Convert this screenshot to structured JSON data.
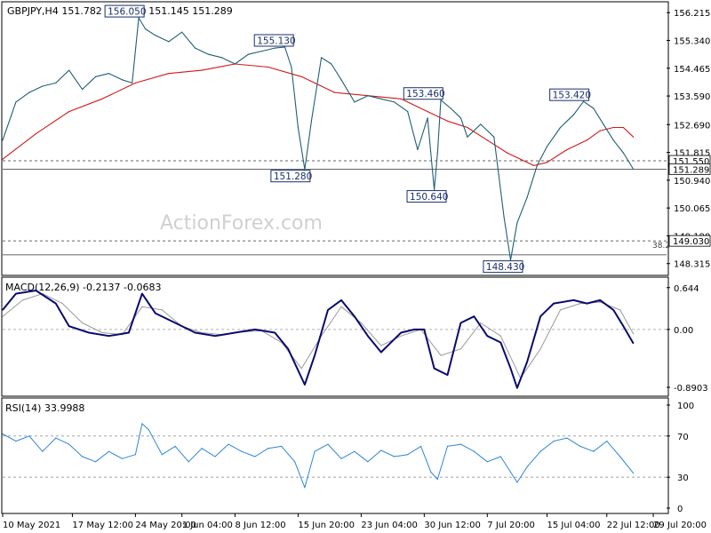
{
  "colors": {
    "price": "#1f5f73",
    "ma": "#d01818",
    "macd_main": "#0a0a70",
    "macd_signal": "#9a9a9a",
    "rsi": "#2e86d6",
    "label_border": "#1a2f6b",
    "axis_text": "#000000",
    "watermark": "#d6d6d6",
    "level_line": "#333333",
    "grid_dash": "#999999"
  },
  "chart_data": [
    {
      "type": "line",
      "header": "GBPJPY,H4  151.782 151.782 151.145 151.289",
      "watermark": "ActionForex.com",
      "yaxis_ticks": [
        "156.215",
        "155.340",
        "154.465",
        "153.590",
        "152.690",
        "151.815",
        "150.940",
        "150.065",
        "149.190",
        "148.315"
      ],
      "ylim": [
        148.0,
        156.5
      ],
      "current_price": "151.289",
      "horizontal_levels": [
        {
          "value": 151.55,
          "label": "151.550",
          "style": "dashed"
        },
        {
          "value": 151.289,
          "label": "151.289",
          "style": "solid"
        },
        {
          "value": 149.03,
          "label": "149.030",
          "style": "dashed",
          "note": "38.2"
        },
        {
          "value": 148.59,
          "label": "",
          "style": "solid"
        }
      ],
      "annotations": [
        {
          "text": "156.050",
          "x": 0.205
        },
        {
          "text": "155.130",
          "x": 0.43
        },
        {
          "text": "151.280",
          "x": 0.455
        },
        {
          "text": "153.460",
          "x": 0.655
        },
        {
          "text": "150.640",
          "x": 0.66
        },
        {
          "text": "148.430",
          "x": 0.775
        },
        {
          "text": "153.420",
          "x": 0.875
        }
      ],
      "series": [
        {
          "name": "price",
          "x": [
            0,
            0.02,
            0.04,
            0.06,
            0.08,
            0.1,
            0.12,
            0.14,
            0.16,
            0.18,
            0.195,
            0.205,
            0.215,
            0.23,
            0.25,
            0.27,
            0.29,
            0.31,
            0.33,
            0.35,
            0.37,
            0.39,
            0.41,
            0.425,
            0.435,
            0.445,
            0.455,
            0.465,
            0.48,
            0.495,
            0.51,
            0.53,
            0.55,
            0.57,
            0.59,
            0.61,
            0.625,
            0.64,
            0.65,
            0.655,
            0.66,
            0.675,
            0.69,
            0.7,
            0.72,
            0.74,
            0.755,
            0.765,
            0.775,
            0.79,
            0.805,
            0.82,
            0.84,
            0.86,
            0.875,
            0.89,
            0.905,
            0.92,
            0.935,
            0.95
          ],
          "values": [
            152.2,
            153.4,
            153.7,
            153.9,
            154.0,
            154.4,
            153.8,
            154.2,
            154.3,
            154.1,
            154.0,
            156.05,
            155.7,
            155.5,
            155.3,
            155.6,
            155.1,
            154.9,
            154.8,
            154.6,
            154.9,
            155.0,
            155.1,
            155.13,
            154.5,
            152.6,
            151.28,
            152.8,
            154.8,
            154.6,
            154.1,
            153.4,
            153.6,
            153.5,
            153.4,
            153.1,
            151.9,
            152.9,
            150.64,
            151.8,
            153.46,
            153.2,
            152.9,
            152.3,
            152.7,
            152.3,
            149.8,
            148.43,
            149.6,
            150.4,
            151.4,
            152.0,
            152.6,
            153.0,
            153.42,
            153.2,
            152.7,
            152.2,
            151.8,
            151.289
          ]
        },
        {
          "name": "moving-average",
          "x": [
            0,
            0.05,
            0.1,
            0.15,
            0.2,
            0.25,
            0.3,
            0.35,
            0.4,
            0.45,
            0.47,
            0.5,
            0.55,
            0.6,
            0.64,
            0.67,
            0.7,
            0.73,
            0.76,
            0.78,
            0.8,
            0.82,
            0.85,
            0.88,
            0.9,
            0.92,
            0.935,
            0.95
          ],
          "values": [
            151.6,
            152.4,
            153.1,
            153.5,
            154.0,
            154.3,
            154.4,
            154.6,
            154.5,
            154.2,
            154.0,
            153.7,
            153.6,
            153.5,
            153.1,
            152.8,
            152.6,
            152.2,
            151.8,
            151.6,
            151.4,
            151.5,
            151.9,
            152.2,
            152.5,
            152.6,
            152.6,
            152.3
          ]
        }
      ]
    },
    {
      "type": "line",
      "title": "MACD(12,26,9) -0.2137 -0.0683",
      "yaxis_ticks": [
        "0.644",
        "0.00",
        "-0.8903"
      ],
      "ylim": [
        -1.0,
        0.75
      ],
      "series": [
        {
          "name": "main",
          "x": [
            0,
            0.02,
            0.05,
            0.08,
            0.1,
            0.13,
            0.16,
            0.19,
            0.21,
            0.23,
            0.26,
            0.29,
            0.32,
            0.35,
            0.38,
            0.41,
            0.43,
            0.455,
            0.47,
            0.49,
            0.51,
            0.53,
            0.55,
            0.57,
            0.59,
            0.6,
            0.62,
            0.635,
            0.65,
            0.67,
            0.69,
            0.71,
            0.73,
            0.75,
            0.765,
            0.775,
            0.79,
            0.81,
            0.83,
            0.86,
            0.88,
            0.9,
            0.92,
            0.935,
            0.95
          ],
          "values": [
            0.3,
            0.55,
            0.6,
            0.4,
            0.05,
            -0.05,
            -0.1,
            -0.05,
            0.55,
            0.25,
            0.1,
            -0.05,
            -0.1,
            -0.05,
            0.0,
            -0.05,
            -0.3,
            -0.85,
            -0.4,
            0.3,
            0.45,
            0.2,
            -0.1,
            -0.35,
            -0.15,
            -0.05,
            0.0,
            0.0,
            -0.6,
            -0.7,
            0.1,
            0.2,
            -0.1,
            -0.2,
            -0.6,
            -0.9,
            -0.5,
            0.2,
            0.4,
            0.45,
            0.4,
            0.45,
            0.3,
            0.05,
            -0.2137
          ]
        },
        {
          "name": "signal",
          "x": [
            0,
            0.03,
            0.06,
            0.09,
            0.12,
            0.15,
            0.18,
            0.21,
            0.24,
            0.27,
            0.3,
            0.33,
            0.36,
            0.39,
            0.42,
            0.45,
            0.48,
            0.51,
            0.54,
            0.57,
            0.6,
            0.63,
            0.66,
            0.69,
            0.72,
            0.75,
            0.78,
            0.81,
            0.84,
            0.87,
            0.9,
            0.93,
            0.95
          ],
          "values": [
            0.2,
            0.45,
            0.55,
            0.4,
            0.1,
            -0.05,
            -0.08,
            0.35,
            0.3,
            0.05,
            -0.05,
            -0.08,
            -0.04,
            -0.02,
            -0.2,
            -0.6,
            -0.1,
            0.35,
            0.1,
            -0.25,
            -0.1,
            0.0,
            -0.4,
            -0.3,
            0.1,
            -0.1,
            -0.75,
            -0.3,
            0.3,
            0.4,
            0.42,
            0.3,
            -0.0683
          ]
        }
      ]
    },
    {
      "type": "line",
      "title": "RSI(14) 33.9988",
      "yaxis_ticks": [
        "100",
        "70",
        "30",
        "0"
      ],
      "ylim": [
        0,
        100
      ],
      "levels": [
        70,
        30
      ],
      "series": [
        {
          "name": "rsi",
          "x": [
            0,
            0.02,
            0.04,
            0.06,
            0.08,
            0.1,
            0.12,
            0.14,
            0.16,
            0.18,
            0.2,
            0.21,
            0.22,
            0.24,
            0.26,
            0.28,
            0.3,
            0.32,
            0.34,
            0.36,
            0.38,
            0.4,
            0.42,
            0.44,
            0.455,
            0.47,
            0.49,
            0.51,
            0.53,
            0.55,
            0.57,
            0.59,
            0.61,
            0.63,
            0.645,
            0.655,
            0.67,
            0.69,
            0.71,
            0.73,
            0.75,
            0.765,
            0.775,
            0.79,
            0.81,
            0.83,
            0.85,
            0.87,
            0.89,
            0.91,
            0.93,
            0.95
          ],
          "values": [
            72,
            65,
            70,
            55,
            68,
            62,
            50,
            45,
            55,
            48,
            52,
            82,
            76,
            52,
            60,
            45,
            58,
            50,
            62,
            55,
            50,
            58,
            60,
            45,
            20,
            55,
            62,
            48,
            55,
            45,
            56,
            50,
            52,
            60,
            35,
            28,
            60,
            62,
            55,
            45,
            50,
            35,
            25,
            40,
            55,
            65,
            68,
            60,
            55,
            65,
            50,
            33.9988
          ]
        }
      ]
    }
  ],
  "time_axis": {
    "labels": [
      "10 May 2021",
      "17 May 12:00",
      "24 May 20:00",
      "1 Jun 04:00",
      "8 Jun 12:00",
      "15 Jun 20:00",
      "23 Jun 04:00",
      "30 Jun 12:00",
      "7 Jul 20:00",
      "15 Jul 04:00",
      "22 Jul 12:00",
      "29 Jul 20:00"
    ],
    "positions": [
      0.0,
      0.105,
      0.2,
      0.27,
      0.35,
      0.445,
      0.54,
      0.635,
      0.73,
      0.82,
      0.91,
      0.98
    ]
  }
}
